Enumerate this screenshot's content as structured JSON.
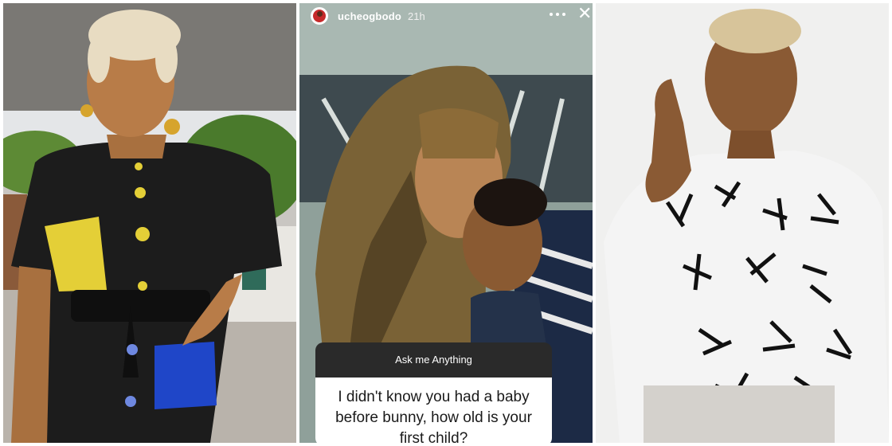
{
  "collage": {
    "panels": [
      "left-photo",
      "story-screenshot",
      "right-photo"
    ]
  },
  "story": {
    "username": "ucheogbodo",
    "time": "21h",
    "icons": [
      "more-icon",
      "close-icon"
    ],
    "question_header": "Ask me Anything",
    "question_text": "I didn't know you had a baby before bunny, how old is your first child?"
  },
  "colors": {
    "background": "#ffffff",
    "sticker_header": "#2a2a2a",
    "dress_black": "#1a1a1a",
    "dress_yellow": "#e8d23a",
    "dress_blue": "#1f46c8"
  }
}
